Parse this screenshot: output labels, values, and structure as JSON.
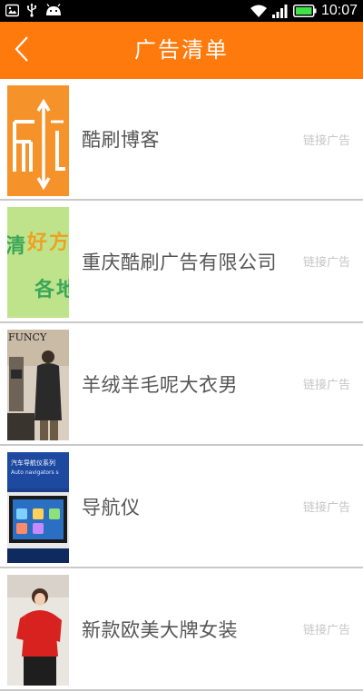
{
  "status_bar": {
    "time": "10:07",
    "icons": [
      "image-icon",
      "usb-icon",
      "android-icon",
      "wifi-icon",
      "signal-icon",
      "battery-icon"
    ]
  },
  "header": {
    "title": "广告清单",
    "back_icon": "chevron-left-icon",
    "background_color": "#ff7a0c"
  },
  "ads": [
    {
      "title": "酷刷博客",
      "link_label": "链接广告",
      "thumb_text": "刷"
    },
    {
      "title": "重庆酷刷广告有限公司",
      "link_label": "链接广告",
      "thumb_text": "清好各"
    },
    {
      "title": "羊绒羊毛呢大衣男",
      "link_label": "链接广告",
      "thumb_text": "FUNCY"
    },
    {
      "title": "导航仪",
      "link_label": "链接广告",
      "thumb_text": "汽车导航仪系列"
    },
    {
      "title": "新款欧美大牌女装",
      "link_label": "链接广告",
      "thumb_text": ""
    }
  ]
}
